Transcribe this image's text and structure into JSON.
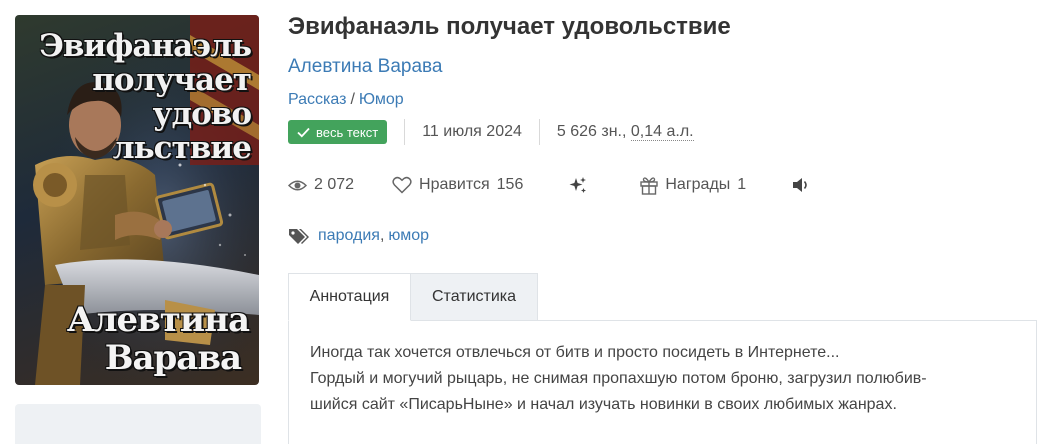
{
  "cover": {
    "title_lines": [
      "Эвифанаэль",
      "получает",
      "удово",
      "льствие"
    ],
    "author_lines": [
      "Алевтина",
      "Варава"
    ]
  },
  "book": {
    "title": "Эвифанаэль получает удовольствие",
    "author": "Алевтина Варава",
    "genre_1": "Рассказ",
    "genre_sep": "/",
    "genre_2": "Юмор"
  },
  "meta": {
    "badge_label": "весь текст",
    "badge_color": "#43a35c",
    "date": "11 июля 2024",
    "size_chars": "5 626 зн.,",
    "size_al": "0,14 а.л."
  },
  "stats": {
    "views": "2 072",
    "likes_label": "Нравится",
    "likes": "156",
    "awards_label": "Награды",
    "awards": "1"
  },
  "tags": {
    "items": [
      "пародия",
      "юмор"
    ],
    "comma": ","
  },
  "tabs": {
    "annotation": "Аннотация",
    "statistics": "Статистика"
  },
  "annotation": {
    "line_1": "Иногда так хочется отвлечься от битв и просто посидеть в Интернете...",
    "line_2": "Гордый и могучий рыцарь, не снимая пропахшую потом броню, загрузил полюбив-",
    "line_3": "шийся сайт «ПисарьНыне» и начал изучать новинки в своих любимых жанрах."
  },
  "colors": {
    "link": "#3c7bb5",
    "text": "#333333",
    "tab_inactive_bg": "#eef1f4"
  }
}
